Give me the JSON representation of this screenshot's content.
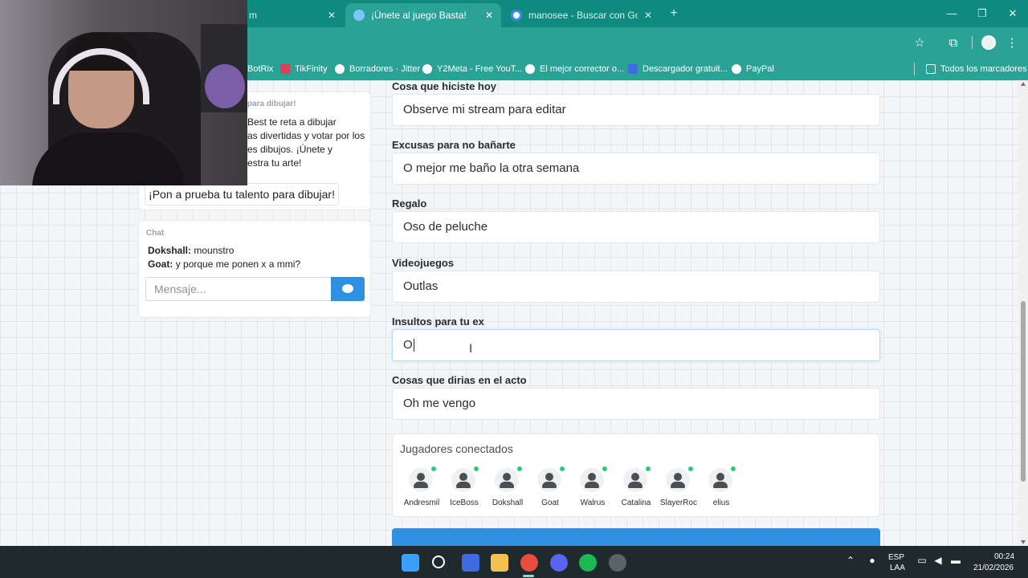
{
  "browser": {
    "tabs": [
      {
        "title": "m",
        "active": false
      },
      {
        "title": "¡Únete al juego Basta!",
        "active": true
      },
      {
        "title": "manosee - Buscar con Google",
        "active": false
      }
    ],
    "bookmarks": [
      "BotRix",
      "TikFinity",
      "Borradores · Jitter",
      "Y2Meta - Free YouT...",
      "El mejor corrector o...",
      "Descargador gratuit...",
      "PayPal"
    ],
    "all_bookmarks": "Todos los marcadores",
    "theme_color": "#2aa396"
  },
  "sidebar": {
    "info_heading": "para dibujar!",
    "info_text": "Best te reta a dibujar\nas divertidas y votar por los\nes dibujos. ¡Únete y\nestra tu arte!",
    "challenge_button": "¡Pon a prueba tu talento para dibujar!",
    "chat": {
      "label": "Chat",
      "messages": [
        {
          "user": "Dokshall:",
          "text": "mounstro"
        },
        {
          "user": "Goat:",
          "text": "y porque me ponen x a mmi?"
        }
      ],
      "input_placeholder": "Mensaje..."
    }
  },
  "form": {
    "fields": [
      {
        "label": "Cosa que hiciste hoy",
        "value": "Observe mi stream para editar"
      },
      {
        "label": "Excusas para no bañarte",
        "value": "O mejor me baño la otra semana"
      },
      {
        "label": "Regalo",
        "value": "Oso de peluche"
      },
      {
        "label": "Videojuegos",
        "value": "Outlas"
      },
      {
        "label": "Insultos para tu ex",
        "value": "O"
      },
      {
        "label": "Cosas que dirias en el acto",
        "value": "Oh me vengo"
      }
    ]
  },
  "players": {
    "title": "Jugadores conectados",
    "list": [
      "Andresmil",
      "IceBoss",
      "Dokshall",
      "Goat",
      "Walrus",
      "Catalina",
      "SlayerRoc",
      "elius"
    ],
    "online_color": "#2ecc71"
  },
  "taskbar": {
    "language": "ESP",
    "language_sub": "LAA",
    "time": "00:24",
    "date": "21/02/2026"
  }
}
